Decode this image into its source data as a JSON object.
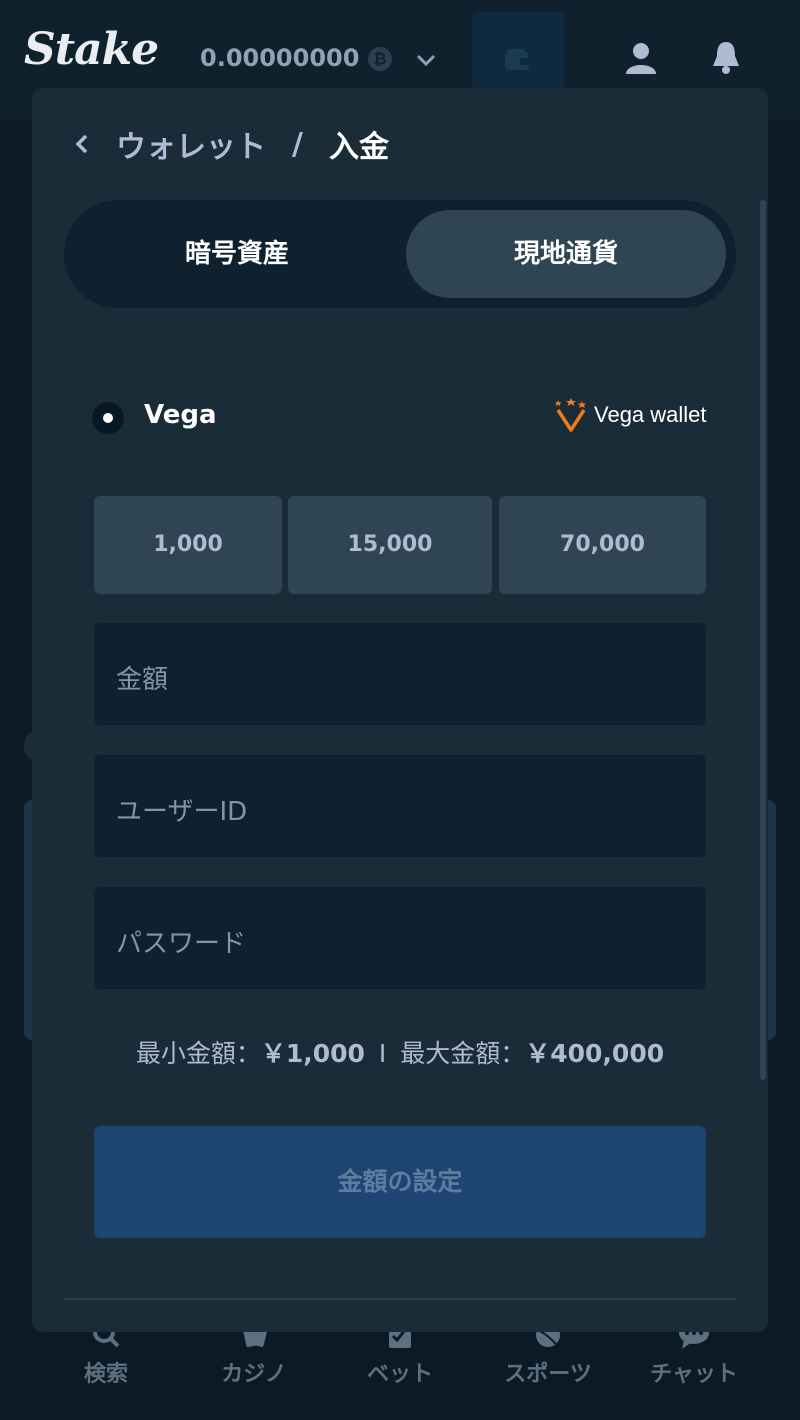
{
  "header": {
    "logo": "Stake",
    "balance": "0.00000000",
    "coin_symbol": "₿"
  },
  "bottom_nav": {
    "items": [
      {
        "label": "検索",
        "icon": "search-icon"
      },
      {
        "label": "カジノ",
        "icon": "cards-icon"
      },
      {
        "label": "ベット",
        "icon": "betslip-icon"
      },
      {
        "label": "スポーツ",
        "icon": "ball-icon"
      },
      {
        "label": "チャット",
        "icon": "chat-icon"
      }
    ]
  },
  "modal": {
    "breadcrumb": {
      "parent": "ウォレット",
      "separator": "/",
      "current": "入金"
    },
    "tabs": [
      {
        "label": "暗号資産",
        "active": false
      },
      {
        "label": "現地通貨",
        "active": true
      }
    ],
    "method": {
      "name": "Vega",
      "logo_text": "Vega wallet",
      "selected": true
    },
    "presets": [
      "1,000",
      "15,000",
      "70,000"
    ],
    "fields": {
      "amount_placeholder": "金額",
      "userid_placeholder": "ユーザーID",
      "password_placeholder": "パスワード"
    },
    "limits": {
      "min_label": "最小金額：",
      "min_value": "￥1,000",
      "divider": "I",
      "max_label": "最大金額：",
      "max_value": "￥400,000"
    },
    "submit_label": "金額の設定"
  },
  "colors": {
    "bg": "#0c1a25",
    "panel": "#1a2c38",
    "input": "#0f212e",
    "accent_button": "#1e4474",
    "vega_orange": "#f07c1a"
  }
}
